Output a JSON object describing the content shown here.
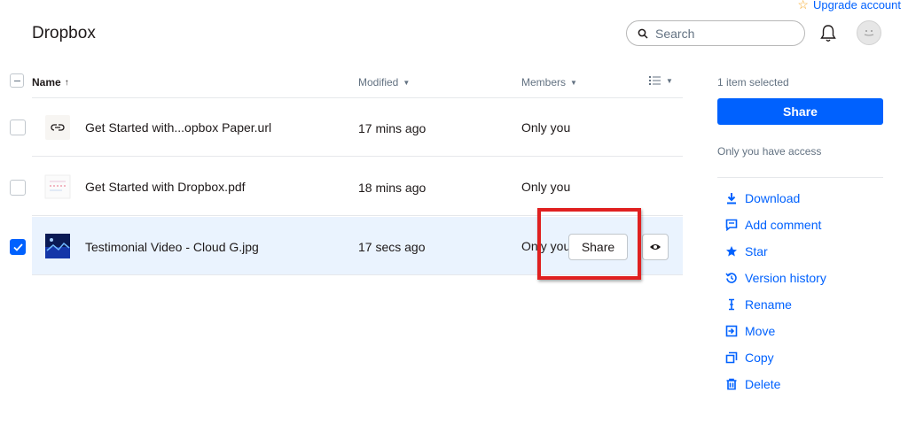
{
  "header": {
    "upgrade_label": "Upgrade account",
    "title": "Dropbox",
    "search_placeholder": "Search"
  },
  "columns": {
    "name": "Name",
    "modified": "Modified",
    "members": "Members"
  },
  "files": [
    {
      "name": "Get Started with...opbox Paper.url",
      "modified": "17 mins ago",
      "members": "Only you",
      "icon": "link-file-icon",
      "selected": false
    },
    {
      "name": "Get Started with Dropbox.pdf",
      "modified": "18 mins ago",
      "members": "Only you",
      "icon": "pdf-thumbnail-icon",
      "selected": false
    },
    {
      "name": "Testimonial Video - Cloud G.jpg",
      "modified": "17 secs ago",
      "members": "Only you",
      "icon": "image-thumbnail-icon",
      "selected": true
    }
  ],
  "row_actions": {
    "share_label": "Share"
  },
  "sidebar": {
    "selected_count": "1 item selected",
    "share_label": "Share",
    "access_text": "Only you have access",
    "actions": [
      {
        "label": "Download",
        "icon": "download-icon"
      },
      {
        "label": "Add comment",
        "icon": "comment-icon"
      },
      {
        "label": "Star",
        "icon": "star-icon"
      },
      {
        "label": "Version history",
        "icon": "history-icon"
      },
      {
        "label": "Rename",
        "icon": "rename-icon"
      },
      {
        "label": "Move",
        "icon": "move-icon"
      },
      {
        "label": "Copy",
        "icon": "copy-icon"
      },
      {
        "label": "Delete",
        "icon": "trash-icon"
      }
    ]
  },
  "colors": {
    "accent": "#0061fe",
    "selected_row": "#eaf3fe",
    "highlight": "#e02020"
  }
}
